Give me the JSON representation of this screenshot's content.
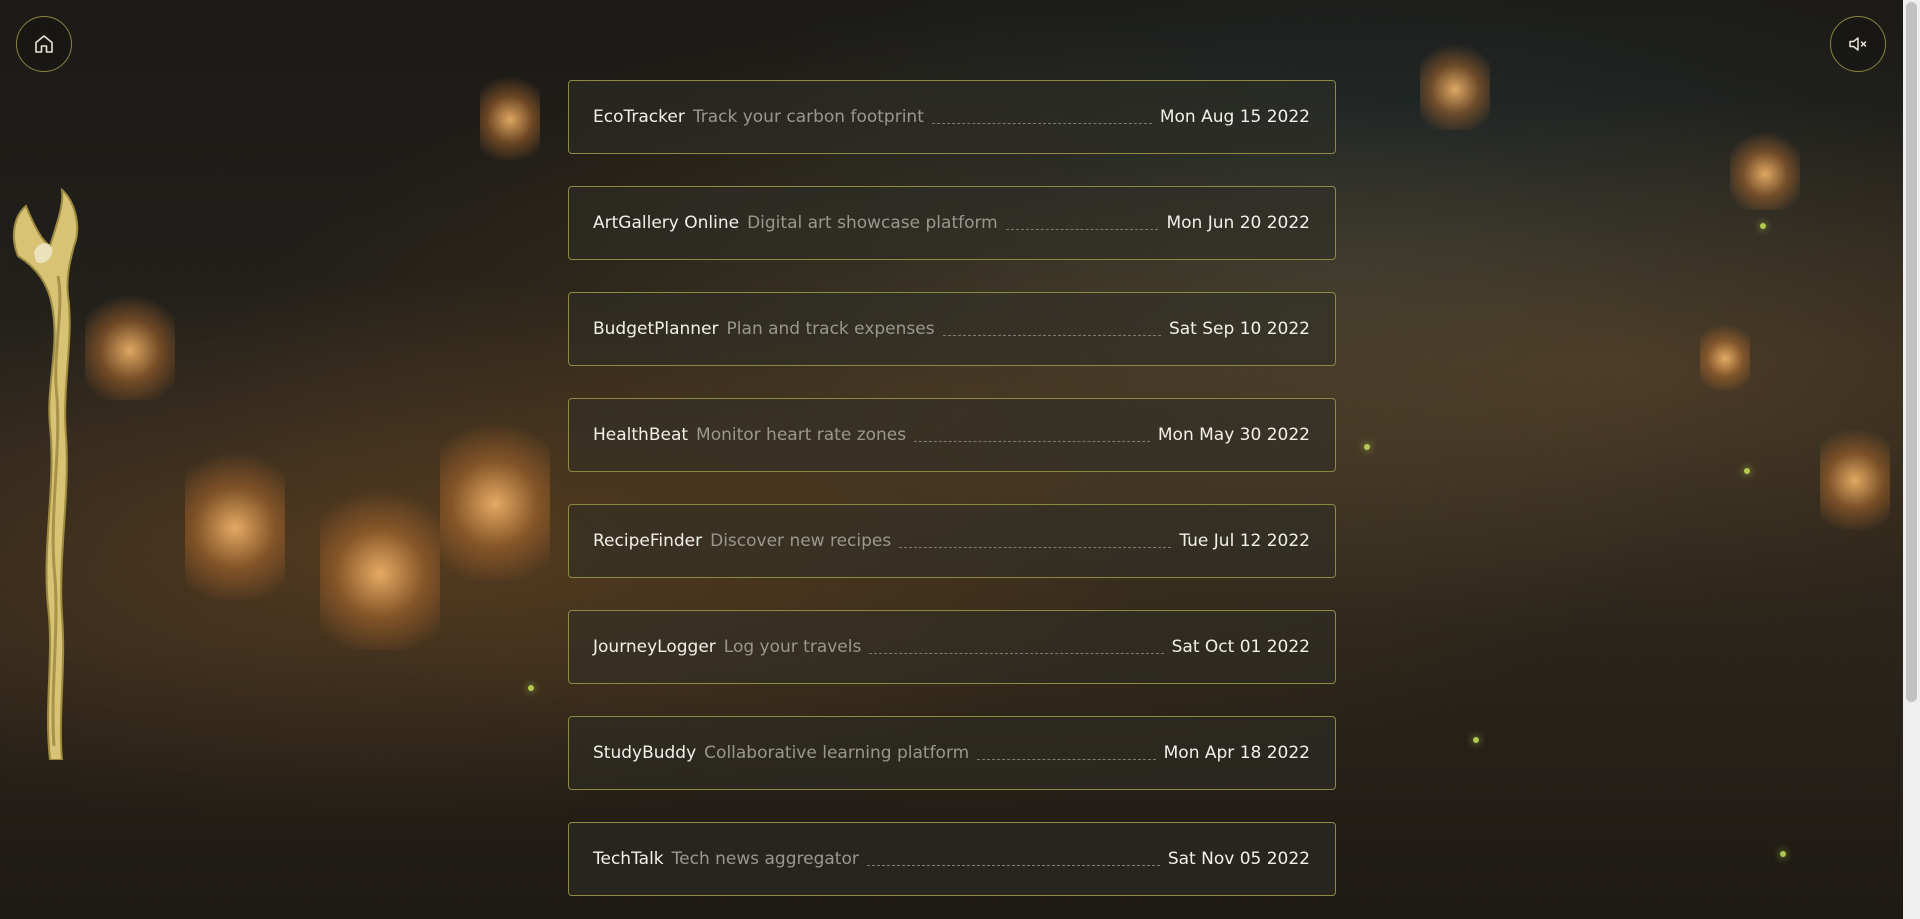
{
  "header": {
    "home_icon": "home-icon",
    "mute_icon": "speaker-muted-icon"
  },
  "projects": [
    {
      "name": "EcoTracker",
      "description": "Track your carbon footprint",
      "date": "Mon Aug 15 2022"
    },
    {
      "name": "ArtGallery Online",
      "description": "Digital art showcase platform",
      "date": "Mon Jun 20 2022"
    },
    {
      "name": "BudgetPlanner",
      "description": "Plan and track expenses",
      "date": "Sat Sep 10 2022"
    },
    {
      "name": "HealthBeat",
      "description": "Monitor heart rate zones",
      "date": "Mon May 30 2022"
    },
    {
      "name": "RecipeFinder",
      "description": "Discover new recipes",
      "date": "Tue Jul 12 2022"
    },
    {
      "name": "JourneyLogger",
      "description": "Log your travels",
      "date": "Sat Oct 01 2022"
    },
    {
      "name": "StudyBuddy",
      "description": "Collaborative learning platform",
      "date": "Mon Apr 18 2022"
    },
    {
      "name": "TechTalk",
      "description": "Tech news aggregator",
      "date": "Sat Nov 05 2022"
    }
  ],
  "colors": {
    "card_border": "#8e8a42",
    "name_text": "#f2f0ea",
    "description_text": "#9a978e"
  }
}
